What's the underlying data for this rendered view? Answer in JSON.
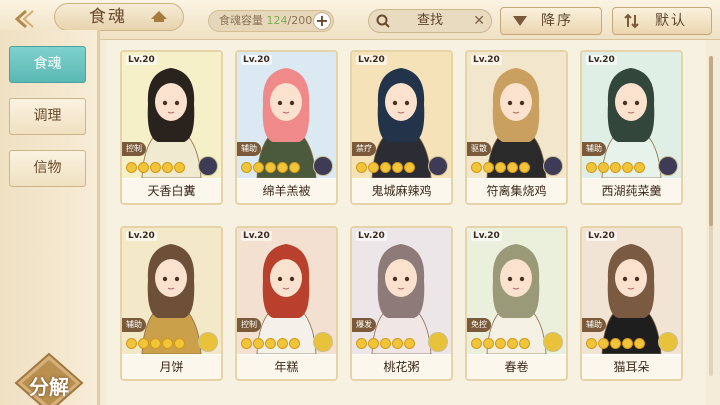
{
  "header": {
    "title": "食魂",
    "capacity_label": "食魂容量",
    "capacity_current": "124",
    "capacity_max": "/200",
    "capacity_add": "+",
    "search_label": "查找",
    "search_clear": "✕",
    "sort_label": "降序",
    "default_label": "默认"
  },
  "sidebar": {
    "items": [
      {
        "label": "食魂",
        "active": true
      },
      {
        "label": "调理",
        "active": false
      },
      {
        "label": "信物",
        "active": false
      }
    ],
    "decompose_label": "分解"
  },
  "cards": [
    {
      "level": "Lv.20",
      "role": "控制",
      "name": "天香白糞",
      "bg": "#f6f0c8",
      "hair": "#2a221c",
      "cloth": "#f0ead0",
      "element": "#3d3b55"
    },
    {
      "level": "Lv.20",
      "role": "辅助",
      "name": "绵羊羔被",
      "bg": "#dbeaf2",
      "hair": "#f08a8a",
      "cloth": "#4a5a3a",
      "element": "#3d3b55"
    },
    {
      "level": "Lv.20",
      "role": "禁疗",
      "name": "鬼城麻辣鸡",
      "bg": "#f5e2b8",
      "hair": "#23344a",
      "cloth": "#2c2c34",
      "element": "#3d3b55"
    },
    {
      "level": "Lv.20",
      "role": "驱散",
      "name": "符离集烧鸡",
      "bg": "#f2e6cc",
      "hair": "#c9a060",
      "cloth": "#2a2a2a",
      "element": "#3d3b55"
    },
    {
      "level": "Lv.20",
      "role": "辅助",
      "name": "西湖莼菜羹",
      "bg": "#e0efe6",
      "hair": "#32463c",
      "cloth": "#e6f2ea",
      "element": "#3d3b55"
    },
    {
      "level": "Lv.20",
      "role": "辅助",
      "name": "月饼",
      "bg": "#f3e8c8",
      "hair": "#6e5038",
      "cloth": "#caa04a",
      "element": "#e8c23a"
    },
    {
      "level": "Lv.20",
      "role": "控制",
      "name": "年糕",
      "bg": "#f3e0d0",
      "hair": "#b8402c",
      "cloth": "#f4f0ea",
      "element": "#e8c23a"
    },
    {
      "level": "Lv.20",
      "role": "爆发",
      "name": "桃花粥",
      "bg": "#ede6e8",
      "hair": "#8e7a78",
      "cloth": "#f0e6e6",
      "element": "#e8c23a"
    },
    {
      "level": "Lv.20",
      "role": "免控",
      "name": "春卷",
      "bg": "#eaf0dc",
      "hair": "#9a9a78",
      "cloth": "#f4f0e4",
      "element": "#e8c23a"
    },
    {
      "level": "Lv.20",
      "role": "辅助",
      "name": "猫耳朵",
      "bg": "#f2e4d4",
      "hair": "#7a5a40",
      "cloth": "#1e1e1e",
      "element": "#e8c23a"
    }
  ],
  "icons": {
    "back": "back-arrow-icon",
    "crest": "crest-icon",
    "search": "search-icon",
    "sort": "sort-arrow-icon",
    "filter": "filter-icon"
  },
  "colors": {
    "accent_teal": "#5bb8b3",
    "star_gold": "#f2c43a",
    "capacity_green": "#7cae55"
  }
}
